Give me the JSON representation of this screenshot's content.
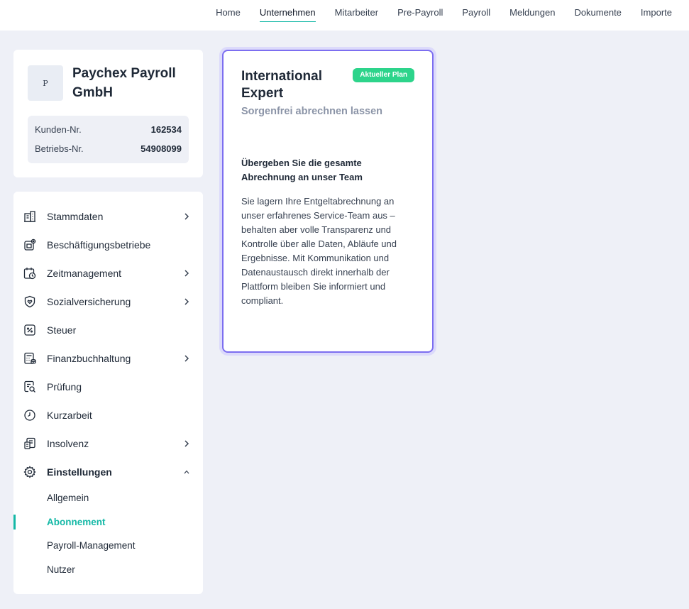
{
  "topnav": {
    "items": [
      {
        "label": "Home"
      },
      {
        "label": "Unternehmen",
        "active": true
      },
      {
        "label": "Mitarbeiter"
      },
      {
        "label": "Pre-Payroll"
      },
      {
        "label": "Payroll"
      },
      {
        "label": "Meldungen"
      },
      {
        "label": "Dokumente"
      },
      {
        "label": "Importe"
      }
    ]
  },
  "company": {
    "logo_letter": "P",
    "name": "Paychex Payroll GmbH",
    "kunden_label": "Kunden-Nr.",
    "kunden_value": "162534",
    "betriebs_label": "Betriebs-Nr.",
    "betriebs_value": "54908099"
  },
  "sidebar": {
    "items": [
      {
        "label": "Stammdaten",
        "icon": "building-icon",
        "chevron": "right"
      },
      {
        "label": "Beschäftigungsbetriebe",
        "icon": "business-location-icon"
      },
      {
        "label": "Zeitmanagement",
        "icon": "calendar-clock-icon",
        "chevron": "right"
      },
      {
        "label": "Sozialversicherung",
        "icon": "shield-icon",
        "chevron": "right"
      },
      {
        "label": "Steuer",
        "icon": "tax-icon"
      },
      {
        "label": "Finanzbuchhaltung",
        "icon": "calculator-icon",
        "chevron": "right"
      },
      {
        "label": "Prüfung",
        "icon": "audit-search-icon"
      },
      {
        "label": "Kurzarbeit",
        "icon": "clock-icon"
      },
      {
        "label": "Insolvenz",
        "icon": "document-stack-icon",
        "chevron": "right"
      },
      {
        "label": "Einstellungen",
        "icon": "gear-icon",
        "chevron": "up",
        "expanded": true
      }
    ],
    "subitems": [
      {
        "label": "Allgemein"
      },
      {
        "label": "Abonnement",
        "active": true
      },
      {
        "label": "Payroll-Management"
      },
      {
        "label": "Nutzer"
      }
    ]
  },
  "plan": {
    "title": "International Expert",
    "badge": "Aktueller Plan",
    "subtitle": "Sorgenfrei abrechnen lassen",
    "headline": "Übergeben Sie die gesamte Abrechnung an unser Team",
    "body": "Sie lagern Ihre Entgeltabrechnung an unser erfahrenes Service-Team aus – behalten aber volle Transparenz und Kontrolle über alle Daten, Abläufe und Ergebnisse. Mit Kommunikation und Datenaustausch direkt innerhalb der Plattform bleiben Sie informiert und compliant."
  },
  "colors": {
    "accent": "#14b8a6",
    "plan_border": "#7c6ef0",
    "badge": "#2dd48b",
    "page_bg": "#eef0f7"
  }
}
